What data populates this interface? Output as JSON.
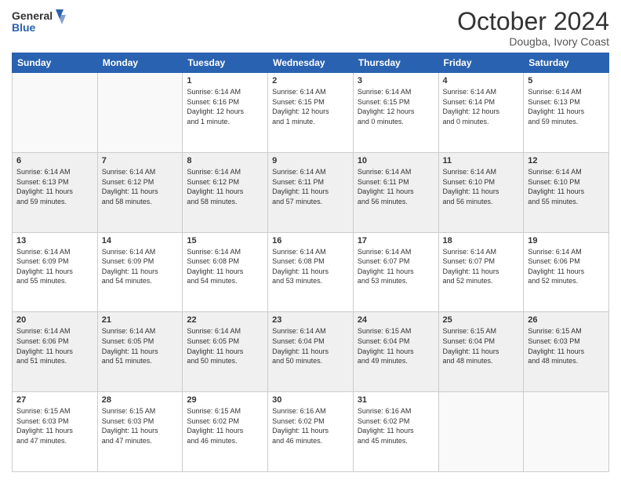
{
  "header": {
    "logo_line1": "General",
    "logo_line2": "Blue",
    "month": "October 2024",
    "location": "Dougba, Ivory Coast"
  },
  "days_of_week": [
    "Sunday",
    "Monday",
    "Tuesday",
    "Wednesday",
    "Thursday",
    "Friday",
    "Saturday"
  ],
  "weeks": [
    {
      "stripe": false,
      "days": [
        {
          "number": "",
          "info": ""
        },
        {
          "number": "",
          "info": ""
        },
        {
          "number": "1",
          "info": "Sunrise: 6:14 AM\nSunset: 6:16 PM\nDaylight: 12 hours\nand 1 minute."
        },
        {
          "number": "2",
          "info": "Sunrise: 6:14 AM\nSunset: 6:15 PM\nDaylight: 12 hours\nand 1 minute."
        },
        {
          "number": "3",
          "info": "Sunrise: 6:14 AM\nSunset: 6:15 PM\nDaylight: 12 hours\nand 0 minutes."
        },
        {
          "number": "4",
          "info": "Sunrise: 6:14 AM\nSunset: 6:14 PM\nDaylight: 12 hours\nand 0 minutes."
        },
        {
          "number": "5",
          "info": "Sunrise: 6:14 AM\nSunset: 6:13 PM\nDaylight: 11 hours\nand 59 minutes."
        }
      ]
    },
    {
      "stripe": true,
      "days": [
        {
          "number": "6",
          "info": "Sunrise: 6:14 AM\nSunset: 6:13 PM\nDaylight: 11 hours\nand 59 minutes."
        },
        {
          "number": "7",
          "info": "Sunrise: 6:14 AM\nSunset: 6:12 PM\nDaylight: 11 hours\nand 58 minutes."
        },
        {
          "number": "8",
          "info": "Sunrise: 6:14 AM\nSunset: 6:12 PM\nDaylight: 11 hours\nand 58 minutes."
        },
        {
          "number": "9",
          "info": "Sunrise: 6:14 AM\nSunset: 6:11 PM\nDaylight: 11 hours\nand 57 minutes."
        },
        {
          "number": "10",
          "info": "Sunrise: 6:14 AM\nSunset: 6:11 PM\nDaylight: 11 hours\nand 56 minutes."
        },
        {
          "number": "11",
          "info": "Sunrise: 6:14 AM\nSunset: 6:10 PM\nDaylight: 11 hours\nand 56 minutes."
        },
        {
          "number": "12",
          "info": "Sunrise: 6:14 AM\nSunset: 6:10 PM\nDaylight: 11 hours\nand 55 minutes."
        }
      ]
    },
    {
      "stripe": false,
      "days": [
        {
          "number": "13",
          "info": "Sunrise: 6:14 AM\nSunset: 6:09 PM\nDaylight: 11 hours\nand 55 minutes."
        },
        {
          "number": "14",
          "info": "Sunrise: 6:14 AM\nSunset: 6:09 PM\nDaylight: 11 hours\nand 54 minutes."
        },
        {
          "number": "15",
          "info": "Sunrise: 6:14 AM\nSunset: 6:08 PM\nDaylight: 11 hours\nand 54 minutes."
        },
        {
          "number": "16",
          "info": "Sunrise: 6:14 AM\nSunset: 6:08 PM\nDaylight: 11 hours\nand 53 minutes."
        },
        {
          "number": "17",
          "info": "Sunrise: 6:14 AM\nSunset: 6:07 PM\nDaylight: 11 hours\nand 53 minutes."
        },
        {
          "number": "18",
          "info": "Sunrise: 6:14 AM\nSunset: 6:07 PM\nDaylight: 11 hours\nand 52 minutes."
        },
        {
          "number": "19",
          "info": "Sunrise: 6:14 AM\nSunset: 6:06 PM\nDaylight: 11 hours\nand 52 minutes."
        }
      ]
    },
    {
      "stripe": true,
      "days": [
        {
          "number": "20",
          "info": "Sunrise: 6:14 AM\nSunset: 6:06 PM\nDaylight: 11 hours\nand 51 minutes."
        },
        {
          "number": "21",
          "info": "Sunrise: 6:14 AM\nSunset: 6:05 PM\nDaylight: 11 hours\nand 51 minutes."
        },
        {
          "number": "22",
          "info": "Sunrise: 6:14 AM\nSunset: 6:05 PM\nDaylight: 11 hours\nand 50 minutes."
        },
        {
          "number": "23",
          "info": "Sunrise: 6:14 AM\nSunset: 6:04 PM\nDaylight: 11 hours\nand 50 minutes."
        },
        {
          "number": "24",
          "info": "Sunrise: 6:15 AM\nSunset: 6:04 PM\nDaylight: 11 hours\nand 49 minutes."
        },
        {
          "number": "25",
          "info": "Sunrise: 6:15 AM\nSunset: 6:04 PM\nDaylight: 11 hours\nand 48 minutes."
        },
        {
          "number": "26",
          "info": "Sunrise: 6:15 AM\nSunset: 6:03 PM\nDaylight: 11 hours\nand 48 minutes."
        }
      ]
    },
    {
      "stripe": false,
      "days": [
        {
          "number": "27",
          "info": "Sunrise: 6:15 AM\nSunset: 6:03 PM\nDaylight: 11 hours\nand 47 minutes."
        },
        {
          "number": "28",
          "info": "Sunrise: 6:15 AM\nSunset: 6:03 PM\nDaylight: 11 hours\nand 47 minutes."
        },
        {
          "number": "29",
          "info": "Sunrise: 6:15 AM\nSunset: 6:02 PM\nDaylight: 11 hours\nand 46 minutes."
        },
        {
          "number": "30",
          "info": "Sunrise: 6:16 AM\nSunset: 6:02 PM\nDaylight: 11 hours\nand 46 minutes."
        },
        {
          "number": "31",
          "info": "Sunrise: 6:16 AM\nSunset: 6:02 PM\nDaylight: 11 hours\nand 45 minutes."
        },
        {
          "number": "",
          "info": ""
        },
        {
          "number": "",
          "info": ""
        }
      ]
    }
  ]
}
